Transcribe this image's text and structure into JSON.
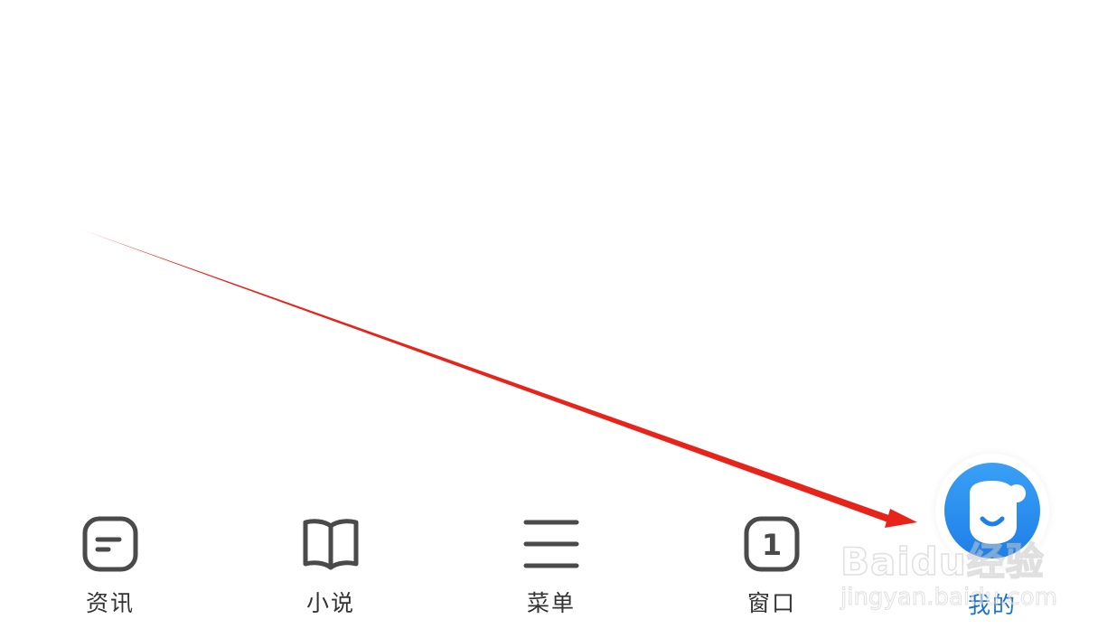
{
  "bottom_nav": {
    "items": [
      {
        "label": "资讯",
        "icon": "news-icon",
        "active": false
      },
      {
        "label": "小说",
        "icon": "book-icon",
        "active": false
      },
      {
        "label": "菜单",
        "icon": "menu-icon",
        "active": false
      },
      {
        "label": "窗口",
        "icon": "window-count-icon",
        "badge": "1",
        "active": false
      },
      {
        "label": "我的",
        "icon": "smiley-avatar-icon",
        "active": true
      }
    ]
  },
  "watermark": {
    "logo": "Baidu经验",
    "url": "jingyan.baidu.com"
  },
  "colors": {
    "background": "#ffffff",
    "icon": "#4a4a4a",
    "label": "#333333",
    "active_label": "#1a73c8",
    "avatar": "#2b8ef0",
    "annotation_arrow": "#e8231a"
  }
}
